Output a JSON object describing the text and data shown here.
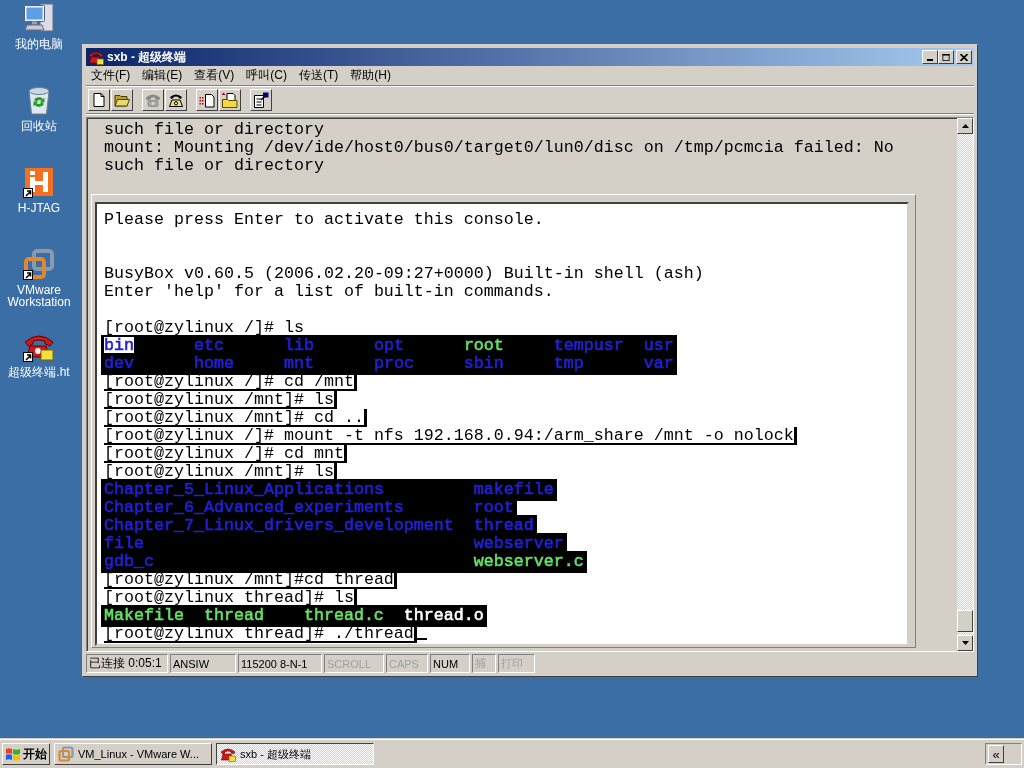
{
  "desktop_icons": [
    {
      "label": "我的电脑",
      "shortcut": false
    },
    {
      "label": "回收站",
      "shortcut": false
    },
    {
      "label": "H-JTAG",
      "shortcut": true
    },
    {
      "label": "VMware Workstation",
      "shortcut": true
    },
    {
      "label": "超级终端.ht",
      "shortcut": true
    }
  ],
  "window": {
    "title": "sxb - 超级终端",
    "menu": [
      "文件(F)",
      "编辑(E)",
      "查看(V)",
      "呼叫(C)",
      "传送(T)",
      "帮助(H)"
    ],
    "toolbar": [
      [
        {
          "disabled": false
        },
        {
          "disabled": false
        }
      ],
      [
        {
          "disabled": true
        },
        {
          "disabled": false
        }
      ],
      [
        {
          "disabled": false
        },
        {
          "disabled": false
        }
      ],
      [
        {
          "disabled": false
        }
      ]
    ]
  },
  "terminal": {
    "lines": [
      "such file or directory",
      "mount: Mounting /dev/ide/host0/bus0/target0/lun0/disc on /tmp/pcmcia failed: No",
      "such file or directory"
    ],
    "console": {
      "cursor": true,
      "lines": [
        {
          "kind": "plain",
          "text": "Please press Enter to activate this console."
        },
        {
          "kind": "blank"
        },
        {
          "kind": "blank"
        },
        {
          "kind": "plain",
          "text": "BusyBox v0.60.5 (2006.02.20-09:27+0000) Built-in shell (ash)"
        },
        {
          "kind": "plain",
          "text": "Enter 'help' for a list of built-in commands."
        },
        {
          "kind": "blank"
        },
        {
          "kind": "plain",
          "text": "[root@zylinux /]# ls"
        },
        {
          "kind": "listing",
          "rows": [
            [
              {
                "text": "bin",
                "color": "#2020d8",
                "highlighted": true
              },
              {
                "text": "etc",
                "color": "#2020d8",
                "highlighted": false
              },
              {
                "text": "lib",
                "color": "#2020d8",
                "highlighted": false
              },
              {
                "text": "opt",
                "color": "#2020d8",
                "highlighted": false
              },
              {
                "text": "root",
                "color": "#66e066",
                "highlighted": false
              },
              {
                "text": "tempusr",
                "color": "#2020d8",
                "highlighted": false
              },
              {
                "text": "usr",
                "color": "#2020d8",
                "highlighted": false
              }
            ],
            [
              {
                "text": "dev",
                "color": "#2020d8",
                "highlighted": false
              },
              {
                "text": "home",
                "color": "#2020d8",
                "highlighted": false
              },
              {
                "text": "mnt",
                "color": "#2020d8",
                "highlighted": false
              },
              {
                "text": "proc",
                "color": "#2020d8",
                "highlighted": false
              },
              {
                "text": "sbin",
                "color": "#2020d8",
                "highlighted": false
              },
              {
                "text": "tmp",
                "color": "#2020d8",
                "highlighted": false
              },
              {
                "text": "var",
                "color": "#2020d8",
                "highlighted": false
              }
            ]
          ]
        },
        {
          "kind": "shaded",
          "text": "[root@zylinux /]# cd /mnt"
        },
        {
          "kind": "shaded",
          "text": "[root@zylinux /mnt]# ls"
        },
        {
          "kind": "shaded",
          "text": "[root@zylinux /mnt]# cd .."
        },
        {
          "kind": "shaded",
          "text": "[root@zylinux /]# mount -t nfs 192.168.0.94:/arm_share /mnt -o nolock"
        },
        {
          "kind": "shaded",
          "text": "[root@zylinux /]# cd mnt"
        },
        {
          "kind": "shaded",
          "text": "[root@zylinux /mnt]# ls"
        },
        {
          "kind": "listing",
          "rows": [
            [
              {
                "text": "Chapter_5_Linux_Applications",
                "color": "#2020d8",
                "highlighted": false
              },
              {
                "text": "makefile",
                "color": "#2020d8",
                "highlighted": false
              }
            ],
            [
              {
                "text": "Chapter_6_Advanced_experiments",
                "color": "#2020d8",
                "highlighted": false
              },
              {
                "text": "root",
                "color": "#2020d8",
                "highlighted": false
              }
            ],
            [
              {
                "text": "Chapter_7_Linux_drivers_development",
                "color": "#2020d8",
                "highlighted": false
              },
              {
                "text": "thread",
                "color": "#2020d8",
                "highlighted": false
              }
            ],
            [
              {
                "text": "file",
                "color": "#2020d8",
                "highlighted": false
              },
              {
                "text": "webserver",
                "color": "#2020d8",
                "highlighted": false
              }
            ],
            [
              {
                "text": "gdb_c",
                "color": "#2020d8",
                "highlighted": false
              },
              {
                "text": "webserver.c",
                "color": "#66e066",
                "highlighted": false
              }
            ]
          ]
        },
        {
          "kind": "shaded",
          "text": "[root@zylinux /mnt]#cd thread"
        },
        {
          "kind": "shaded",
          "text": "[root@zylinux thread]# ls"
        },
        {
          "kind": "listing",
          "rows": [
            [
              {
                "text": "Makefile",
                "color": "#66e066",
                "highlighted": false
              },
              {
                "text": "thread",
                "color": "#66e066",
                "highlighted": false
              },
              {
                "text": "thread.c",
                "color": "#66e066",
                "highlighted": false
              },
              {
                "text": "thread.o",
                "color": "#ffffff",
                "highlighted": false
              }
            ]
          ]
        },
        {
          "kind": "shaded",
          "text": "[root@zylinux thread]# ./thread"
        }
      ]
    }
  },
  "status_bar": [
    {
      "text": "已连接 0:05:1",
      "on": true
    },
    {
      "text": "ANSIW",
      "on": true
    },
    {
      "text": "115200 8-N-1",
      "on": true
    },
    {
      "text": "SCROLL",
      "on": false
    },
    {
      "text": "CAPS",
      "on": false
    },
    {
      "text": "NUM",
      "on": true
    },
    {
      "text": "捕",
      "on": false
    },
    {
      "text": "打印",
      "on": false
    }
  ],
  "taskbar": {
    "start": "开始",
    "buttons": [
      {
        "label": "VM_Linux - VMware W...",
        "selected": false
      },
      {
        "label": "sxb - 超级终端",
        "selected": true
      }
    ],
    "tray": {
      "expand": "«"
    }
  }
}
